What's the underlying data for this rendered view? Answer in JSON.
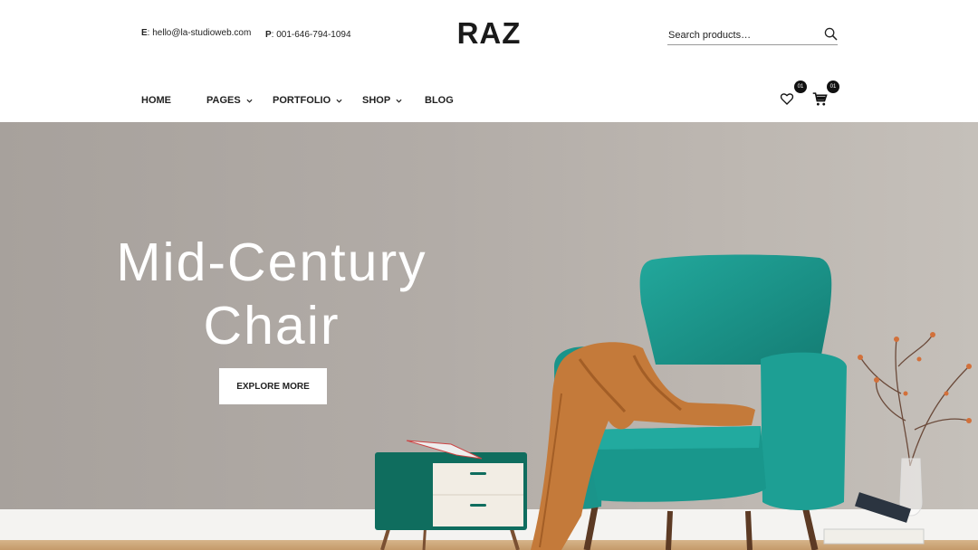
{
  "header": {
    "email_label": "E",
    "email": "hello@la-studioweb.com",
    "phone_label": "P",
    "phone": "001-646-794-1094",
    "logo": "RAZ",
    "search_placeholder": "Search products…"
  },
  "nav": {
    "items": [
      {
        "label": "HOME",
        "has_dropdown": false
      },
      {
        "label": "PAGES",
        "has_dropdown": true
      },
      {
        "label": "PORTFOLIO",
        "has_dropdown": true
      },
      {
        "label": "SHOP",
        "has_dropdown": true
      },
      {
        "label": "BLOG",
        "has_dropdown": false
      }
    ],
    "wishlist_count": "01",
    "cart_count": "01"
  },
  "hero": {
    "title_line1": "Mid-Century",
    "title_line2": "Chair",
    "button_label": "EXPLORE MORE"
  },
  "colors": {
    "accent_teal": "#1a9a90",
    "text": "#222222",
    "hero_bg": "#b2aca7",
    "throw_orange": "#c47a3a"
  },
  "icons": [
    "search-icon",
    "chevron-down-icon",
    "heart-icon",
    "cart-icon"
  ]
}
